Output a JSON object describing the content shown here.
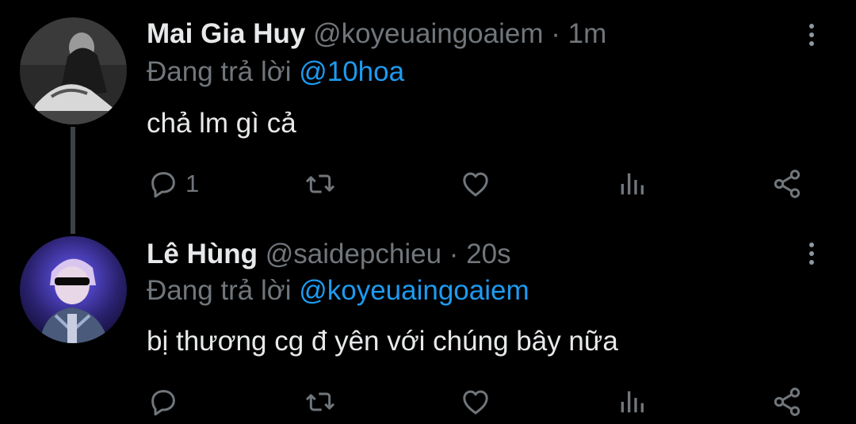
{
  "colors": {
    "background": "#000000",
    "primary_text": "#e7e9ea",
    "secondary_text": "#71767b",
    "mention": "#1d9bf0",
    "icon": "#71767b"
  },
  "tweets": [
    {
      "display_name": "Mai Gia Huy",
      "handle": "@koyeuaingoaiem",
      "separator": "·",
      "time": "1m",
      "replying_label": "Đang trả lời",
      "replying_to": "@10hoa",
      "text": "chả lm gì cả",
      "reply_count": "1",
      "avatar_icon": "avatar-photo"
    },
    {
      "display_name": "Lê Hùng",
      "handle": "@saidepchieu",
      "separator": "·",
      "time": "20s",
      "replying_label": "Đang trả lời",
      "replying_to": "@koyeuaingoaiem",
      "text": "bị thương cg đ yên với chúng bây nữa",
      "reply_count": "",
      "avatar_icon": "avatar-photo"
    }
  ],
  "action_icons": [
    "reply-icon",
    "retweet-icon",
    "like-icon",
    "analytics-icon",
    "share-icon"
  ],
  "more_icon": "more-vertical-icon"
}
